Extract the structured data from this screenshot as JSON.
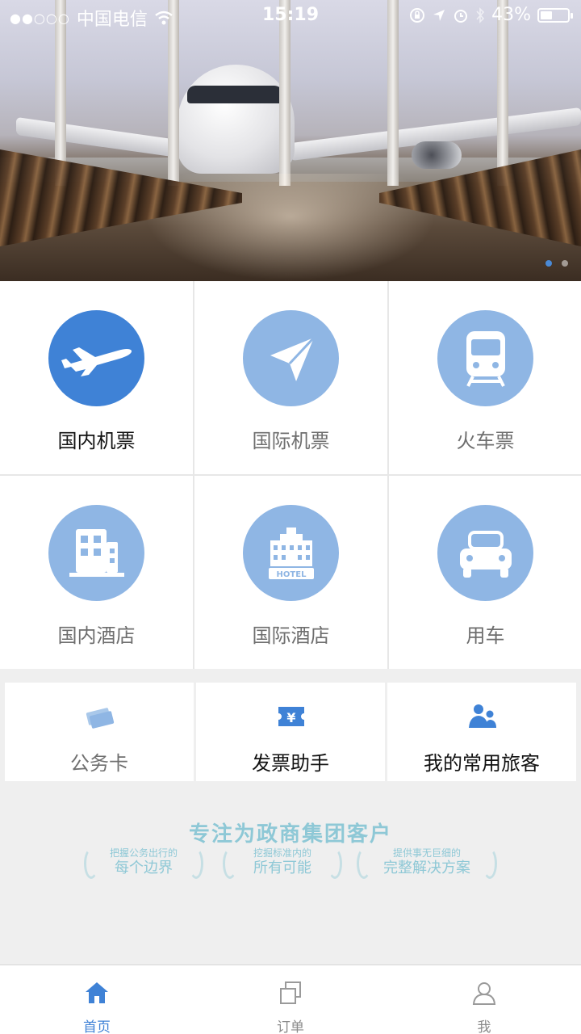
{
  "status_bar": {
    "signal": "●●○○○",
    "carrier": "中国电信",
    "time": "15:19",
    "battery_text": "43%",
    "battery_level": 0.43,
    "icons": [
      "wifi-icon",
      "orientation-lock-icon",
      "location-icon",
      "alarm-icon",
      "bluetooth-icon",
      "battery-icon"
    ]
  },
  "banner": {
    "page_count": 2,
    "active_page": 1
  },
  "services": [
    {
      "id": "domestic-flight",
      "label": "国内机票",
      "icon": "airplane-icon",
      "active": true
    },
    {
      "id": "international-flight",
      "label": "国际机票",
      "icon": "paper-plane-icon",
      "active": false
    },
    {
      "id": "train",
      "label": "火车票",
      "icon": "train-icon",
      "active": false
    },
    {
      "id": "domestic-hotel",
      "label": "国内酒店",
      "icon": "building-icon",
      "active": false
    },
    {
      "id": "international-hotel",
      "label": "国际酒店",
      "icon": "hotel-icon",
      "hotel_sign": "HOTEL",
      "active": false
    },
    {
      "id": "car",
      "label": "用车",
      "icon": "car-icon",
      "active": false
    }
  ],
  "tools": [
    {
      "id": "business-card",
      "label": "公务卡",
      "icon": "cards-icon"
    },
    {
      "id": "invoice-helper",
      "label": "发票助手",
      "icon": "ticket-yen-icon",
      "icon_text": "¥"
    },
    {
      "id": "frequent-travelers",
      "label": "我的常用旅客",
      "icon": "people-icon"
    }
  ],
  "slogan": {
    "title": "专注为政商集团客户",
    "badges": [
      {
        "small": "把握公务出行的",
        "big": "每个边界"
      },
      {
        "small": "挖掘标准内的",
        "big": "所有可能"
      },
      {
        "small": "提供事无巨细的",
        "big": "完整解决方案"
      }
    ]
  },
  "tabbar": {
    "tabs": [
      {
        "label": "首页",
        "icon": "home-icon",
        "active": true
      },
      {
        "label": "订单",
        "icon": "orders-icon",
        "active": false
      },
      {
        "label": "我",
        "icon": "profile-icon",
        "active": false
      }
    ]
  },
  "colors": {
    "accent": "#3f82d6",
    "icon_light": "#8fb6e4",
    "slogan": "#8ec8d6"
  }
}
